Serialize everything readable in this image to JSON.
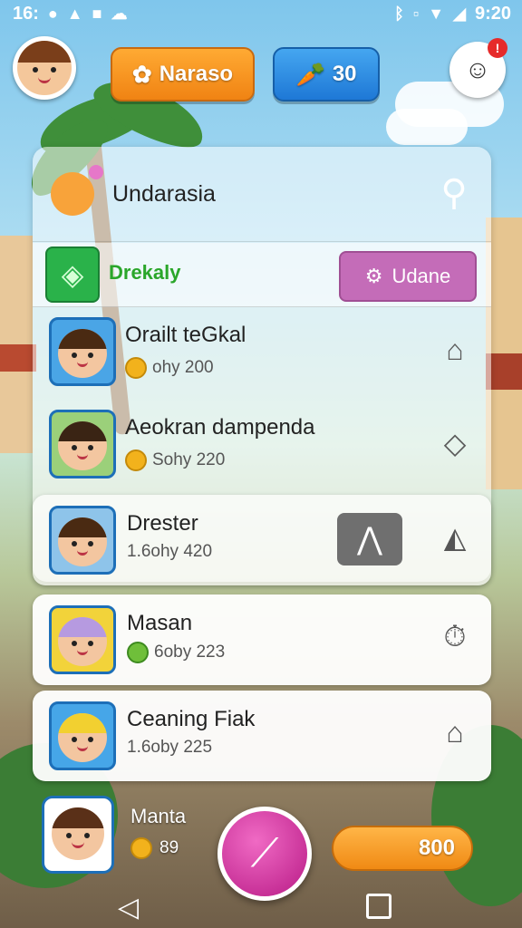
{
  "status": {
    "time_left": "16:",
    "time_right": "9:20"
  },
  "topbar": {
    "name_label": "Naraso",
    "currency_value": "30",
    "notification_count": "!"
  },
  "panel": {
    "title": "Undarasia",
    "ribbon_label": "Drekaly",
    "update_label": "Udane",
    "rows": [
      {
        "name": "Orailt teGkal",
        "sub": "ohy 200"
      },
      {
        "name": "Aeokran dampenda",
        "sub": "Sohy 220"
      }
    ]
  },
  "cards": [
    {
      "name": "Drester",
      "sub": "1.6ohy 420"
    },
    {
      "name": "Masan",
      "sub": "6oby 223"
    },
    {
      "name": "Ceaning Fiak",
      "sub": "1.6oby 225"
    }
  ],
  "bottom": {
    "name": "Manta",
    "sub": "89",
    "cta_label": "800"
  },
  "colors": {
    "accent_orange": "#f08313",
    "accent_blue": "#1e78d6",
    "accent_pink": "#c46cb8",
    "badge_green": "#2ab24a"
  }
}
